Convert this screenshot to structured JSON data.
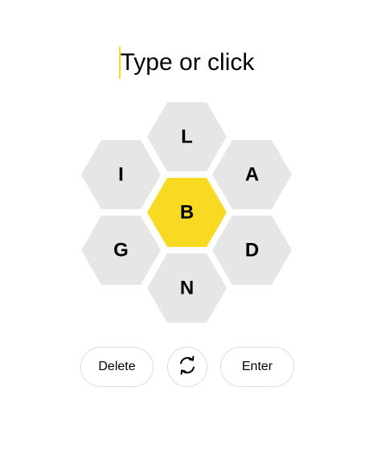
{
  "input": {
    "placeholder": "Type or click"
  },
  "hive": {
    "center_letter": "B",
    "outer_letters": [
      "L",
      "A",
      "D",
      "N",
      "G",
      "I"
    ],
    "colors": {
      "center": "#f7da21",
      "outer": "#e6e6e6"
    }
  },
  "controls": {
    "delete_label": "Delete",
    "shuffle_icon": "shuffle-icon",
    "enter_label": "Enter"
  }
}
